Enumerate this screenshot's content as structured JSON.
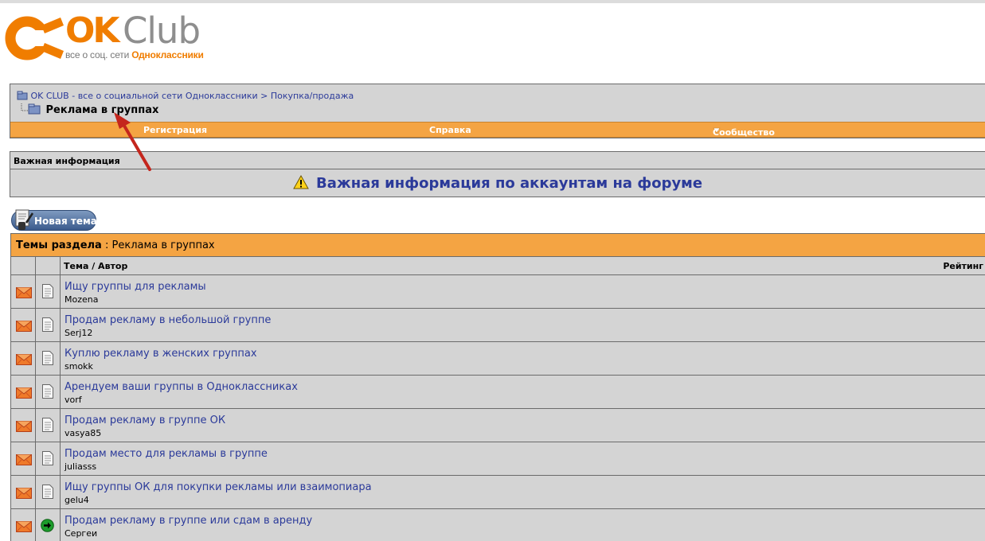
{
  "logo": {
    "brand_ok": "OK",
    "brand_club": "Club",
    "tagline_prefix": "все о соц. сети",
    "tagline_brand": "Одноклассники"
  },
  "breadcrumb": {
    "root": "OK CLUB - все о социальной сети Одноклассники",
    "separator": ">",
    "parent": "Покупка/продажа",
    "current": "Реклама в группах"
  },
  "navbar": {
    "register": "Регистрация",
    "help": "Справка",
    "community": "Сообщество"
  },
  "important": {
    "header": "Важная информация",
    "link": "Важная информация по аккаунтам на форуме"
  },
  "new_topic": {
    "label": "Новая тема"
  },
  "threads": {
    "title_prefix": "Темы раздела",
    "title_sep": " : ",
    "title_forum": "Реклама в группах",
    "col_topic": "Тема / Автор",
    "col_rating": "Рейтинг",
    "rows": [
      {
        "title": "Ищу группы для рекламы",
        "author": "Mozena",
        "icon": "document-icon"
      },
      {
        "title": "Продам рекламу в небольшой группе",
        "author": "Serj12",
        "icon": "document-icon"
      },
      {
        "title": "Куплю рекламу в женских группах",
        "author": "smokk",
        "icon": "document-icon"
      },
      {
        "title": "Арендуем ваши группы в Одноклассниках",
        "author": "vorf",
        "icon": "document-icon"
      },
      {
        "title": "Продам рекламу в группе ОК",
        "author": "vasya85",
        "icon": "document-icon"
      },
      {
        "title": "Продам место для рекламы в группе",
        "author": "juliasss",
        "icon": "document-icon"
      },
      {
        "title": "Ищу группы ОК для покупки рекламы или взаимопиара",
        "author": "gelu4",
        "icon": "document-icon"
      },
      {
        "title": "Продам рекламу в группе или сдам в аренду",
        "author": "Сергеи",
        "icon": "green-arrow-icon"
      }
    ]
  },
  "colors": {
    "orange": "#f4a443",
    "panel_gray": "#d4d4d4",
    "link_blue": "#2b3a9a",
    "brand_orange": "#f07d00",
    "annotation_red": "#c4261d"
  }
}
